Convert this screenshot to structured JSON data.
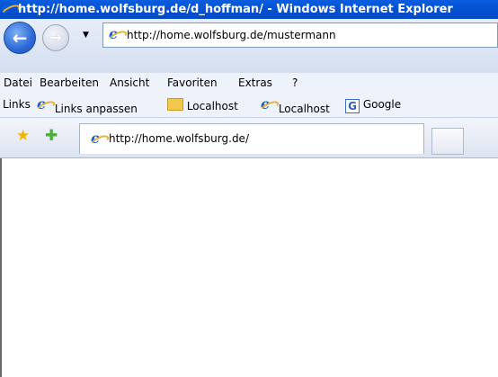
{
  "window": {
    "title": "http://home.wolfsburg.de/d_hoffman/ - Windows Internet Explorer"
  },
  "address_bar": {
    "value": "http://home.wolfsburg.de/mustermann"
  },
  "menu": {
    "items": [
      {
        "label": "Datei"
      },
      {
        "label": "Bearbeiten"
      },
      {
        "label": "Ansicht"
      },
      {
        "label": "Favoriten"
      },
      {
        "label": "Extras"
      },
      {
        "label": "?"
      }
    ]
  },
  "links_bar": {
    "label": "Links",
    "items": [
      {
        "label": "Links anpassen",
        "icon": "ie-icon"
      },
      {
        "label": "Localhost",
        "icon": "folder-icon"
      },
      {
        "label": "Localhost",
        "icon": "ie-icon"
      },
      {
        "label": "Google",
        "icon": "google-icon"
      }
    ]
  },
  "tab": {
    "label": "http://home.wolfsburg.de/"
  },
  "colors": {
    "titlebar": "#0553d3",
    "toolbar": "#eef2fa"
  }
}
